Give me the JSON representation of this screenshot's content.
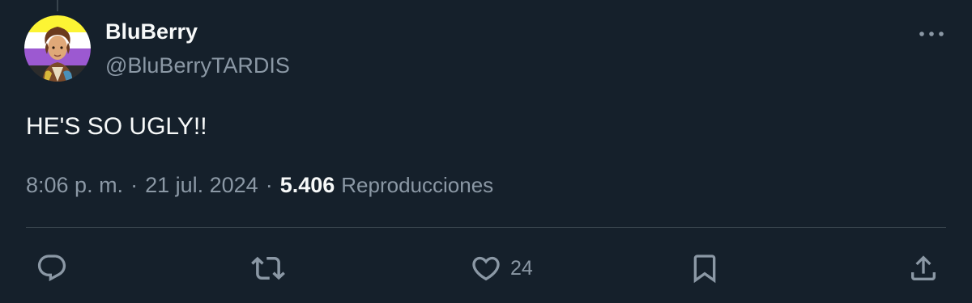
{
  "tweet": {
    "author": {
      "display_name": "BluBerry",
      "handle": "@BluBerryTARDIS"
    },
    "text": "HE'S SO UGLY!!",
    "time": "8:06 p. m.",
    "date": "21 jul. 2024",
    "views_count": "5.406",
    "views_label": "Reproducciones"
  },
  "actions": {
    "reply_icon": "reply-icon",
    "retweet_icon": "retweet-icon",
    "like_icon": "heart-icon",
    "like_count": "24",
    "bookmark_icon": "bookmark-icon",
    "share_icon": "share-icon"
  },
  "colors": {
    "background": "#15202b",
    "primary_text": "#f7f9f9",
    "secondary_text": "#8b98a5",
    "divider": "#38444d"
  }
}
